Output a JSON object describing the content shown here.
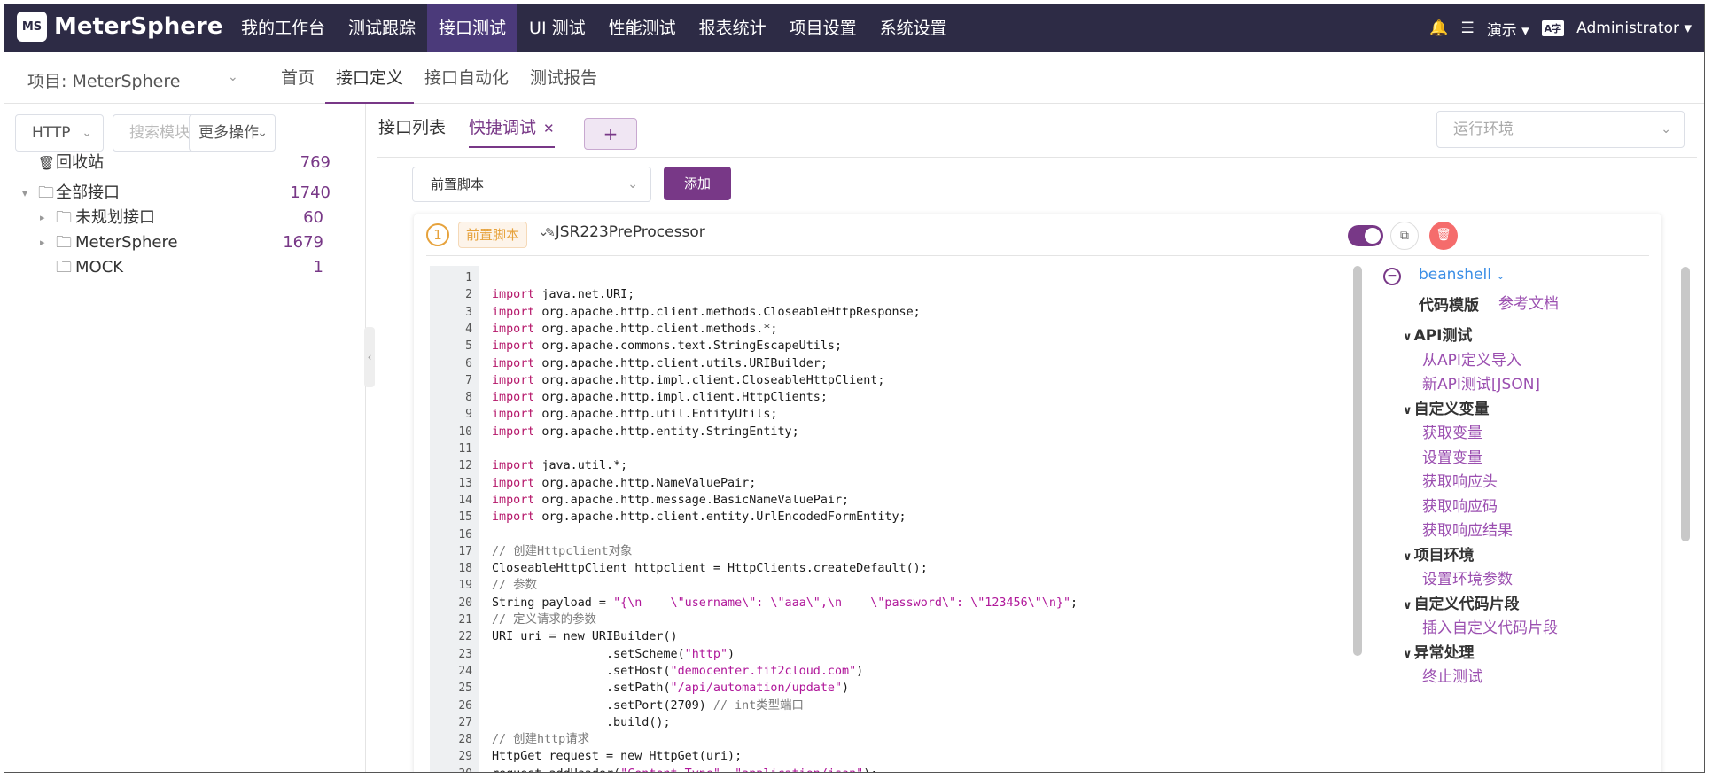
{
  "app": {
    "logo_badge": "MS",
    "logo_text": "MeterSphere"
  },
  "nav": {
    "items": [
      "我的工作台",
      "测试跟踪",
      "接口测试",
      "UI 测试",
      "性能测试",
      "报表统计",
      "项目设置",
      "系统设置"
    ],
    "active_index": 2
  },
  "header_right": {
    "workspace": "演示",
    "user": "Administrator"
  },
  "subbar": {
    "project": "项目: MeterSphere",
    "items": [
      "首页",
      "接口定义",
      "接口自动化",
      "测试报告"
    ],
    "active_index": 1
  },
  "left": {
    "protocol": "HTTP",
    "search_placeholder": "搜索模块",
    "more_ops": "更多操作",
    "recycle": {
      "label": "回收站",
      "count": "769"
    },
    "tree": [
      {
        "label": "全部接口",
        "count": "1740"
      },
      {
        "label": "未规划接口",
        "count": "60"
      },
      {
        "label": "MeterSphere",
        "count": "1679"
      },
      {
        "label": "MOCK",
        "count": "1"
      }
    ]
  },
  "tabs": {
    "list": "接口列表",
    "quick": "快捷调试",
    "add": "+",
    "env_placeholder": "运行环境"
  },
  "processor": {
    "select": "前置脚本",
    "add": "添加",
    "step": "1",
    "tag": "前置脚本",
    "name": "JSR223PreProcessor",
    "enabled": true
  },
  "editor": {
    "lines": [
      "",
      "import java.net.URI;",
      "import org.apache.http.client.methods.CloseableHttpResponse;",
      "import org.apache.http.client.methods.*;",
      "import org.apache.commons.text.StringEscapeUtils;",
      "import org.apache.http.client.utils.URIBuilder;",
      "import org.apache.http.impl.client.CloseableHttpClient;",
      "import org.apache.http.impl.client.HttpClients;",
      "import org.apache.http.util.EntityUtils;",
      "import org.apache.http.entity.StringEntity;",
      "",
      "import java.util.*;",
      "import org.apache.http.NameValuePair;",
      "import org.apache.http.message.BasicNameValuePair;",
      "import org.apache.http.client.entity.UrlEncodedFormEntity;",
      "",
      "// 创建Httpclient对象",
      "CloseableHttpClient httpclient = HttpClients.createDefault();",
      "// 参数",
      "String payload = \"{\\n    \\\"username\\\": \\\"aaa\\\",\\n    \\\"password\\\": \\\"123456\\\"\\n}\";",
      "// 定义请求的参数",
      "URI uri = new URIBuilder()",
      "                .setScheme(\"http\")",
      "                .setHost(\"democenter.fit2cloud.com\")",
      "                .setPath(\"/api/automation/update\")",
      "                .setPort(2709) // int类型端口",
      "                .build();",
      "// 创建http请求",
      "HttpGet request = new HttpGet(uri);",
      "request.addHeader(\"Content-Type\", \"application/json\");"
    ]
  },
  "side": {
    "language": "beanshell",
    "template_title": "代码模版",
    "doc_link": "参考文档",
    "sections": [
      {
        "title": "API测试",
        "links": [
          "从API定义导入",
          "新API测试[JSON]"
        ]
      },
      {
        "title": "自定义变量",
        "links": [
          "获取变量",
          "设置变量",
          "获取响应头",
          "获取响应码",
          "获取响应结果"
        ]
      },
      {
        "title": "项目环境",
        "links": [
          "设置环境参数"
        ]
      },
      {
        "title": "自定义代码片段",
        "links": [
          "插入自定义代码片段"
        ]
      },
      {
        "title": "异常处理",
        "links": [
          "终止测试"
        ]
      }
    ]
  }
}
